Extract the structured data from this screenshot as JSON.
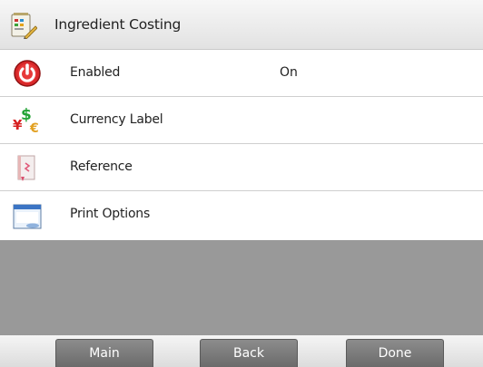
{
  "header": {
    "title": "Ingredient Costing",
    "icon": "ingredient-costing-icon"
  },
  "rows": [
    {
      "label": "Enabled",
      "value": "On",
      "icon": "power-icon"
    },
    {
      "label": "Currency Label",
      "value": "",
      "icon": "currency-icon"
    },
    {
      "label": "Reference",
      "value": "",
      "icon": "reference-icon"
    },
    {
      "label": "Print Options",
      "value": "",
      "icon": "print-options-icon"
    }
  ],
  "footer": {
    "main_label": "Main",
    "back_label": "Back",
    "done_label": "Done"
  },
  "colors": {
    "content_background": "#999999",
    "button": "#7a7a7a",
    "power_red": "#d9282a"
  }
}
